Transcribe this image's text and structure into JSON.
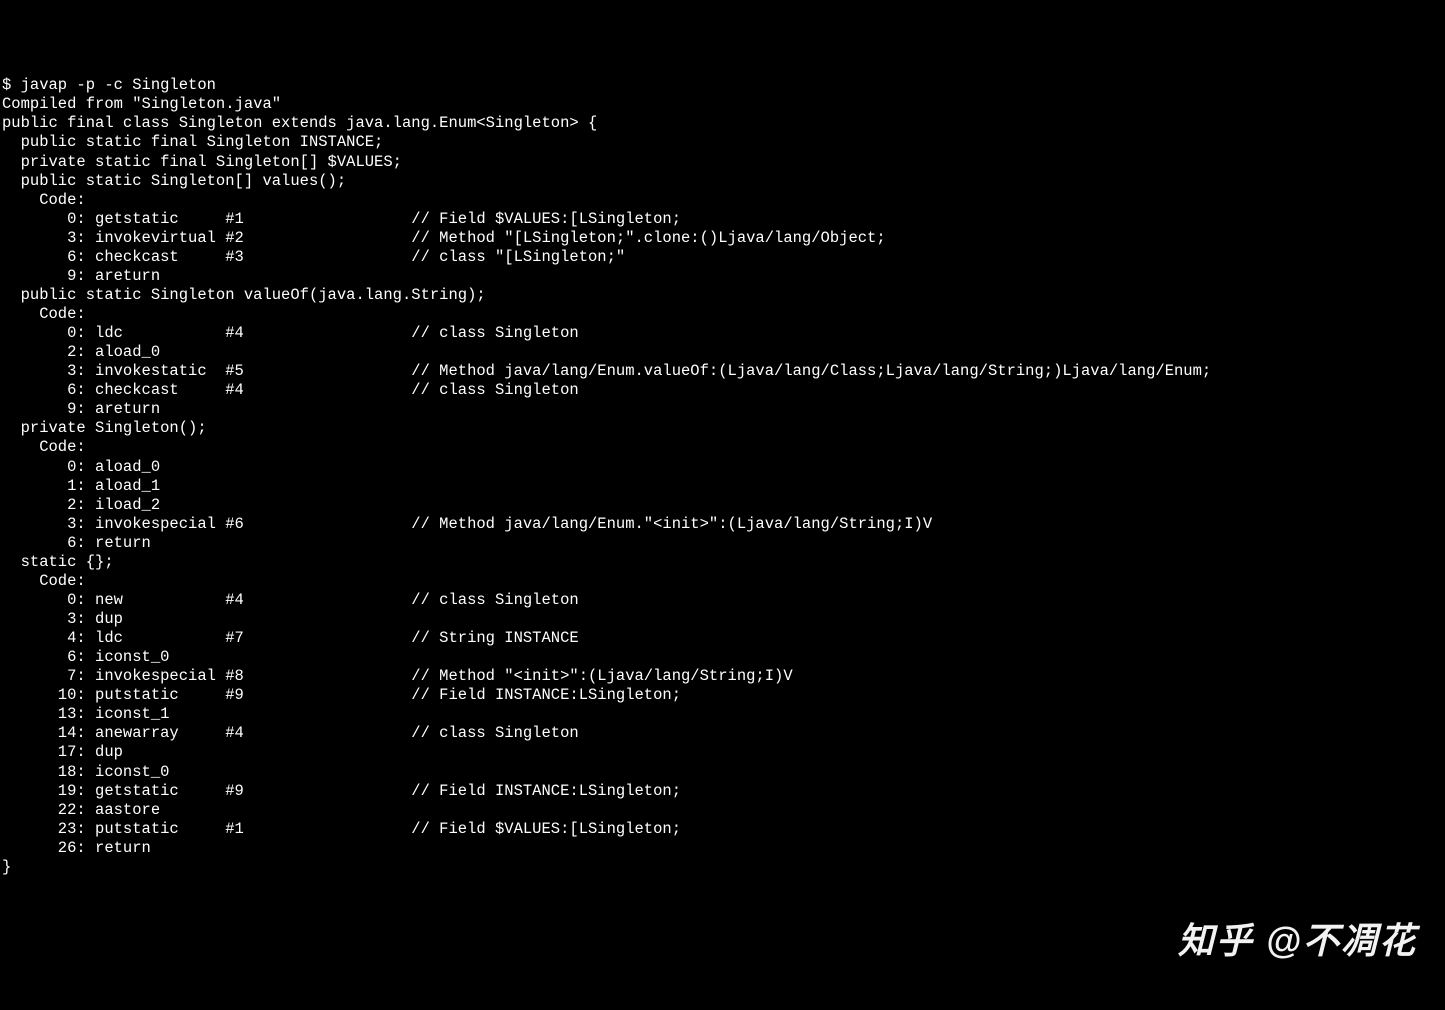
{
  "watermark": "知乎 @不凋花",
  "lines": [
    "$ javap -p -c Singleton",
    "Compiled from \"Singleton.java\"",
    "public final class Singleton extends java.lang.Enum<Singleton> {",
    "  public static final Singleton INSTANCE;",
    "",
    "  private static final Singleton[] $VALUES;",
    "",
    "  public static Singleton[] values();",
    "    Code:",
    "       0: getstatic     #1                  // Field $VALUES:[LSingleton;",
    "       3: invokevirtual #2                  // Method \"[LSingleton;\".clone:()Ljava/lang/Object;",
    "       6: checkcast     #3                  // class \"[LSingleton;\"",
    "       9: areturn",
    "",
    "  public static Singleton valueOf(java.lang.String);",
    "    Code:",
    "       0: ldc           #4                  // class Singleton",
    "       2: aload_0",
    "       3: invokestatic  #5                  // Method java/lang/Enum.valueOf:(Ljava/lang/Class;Ljava/lang/String;)Ljava/lang/Enum;",
    "       6: checkcast     #4                  // class Singleton",
    "       9: areturn",
    "",
    "  private Singleton();",
    "    Code:",
    "       0: aload_0",
    "       1: aload_1",
    "       2: iload_2",
    "       3: invokespecial #6                  // Method java/lang/Enum.\"<init>\":(Ljava/lang/String;I)V",
    "       6: return",
    "",
    "  static {};",
    "    Code:",
    "       0: new           #4                  // class Singleton",
    "       3: dup",
    "       4: ldc           #7                  // String INSTANCE",
    "       6: iconst_0",
    "       7: invokespecial #8                  // Method \"<init>\":(Ljava/lang/String;I)V",
    "      10: putstatic     #9                  // Field INSTANCE:LSingleton;",
    "      13: iconst_1",
    "      14: anewarray     #4                  // class Singleton",
    "      17: dup",
    "      18: iconst_0",
    "      19: getstatic     #9                  // Field INSTANCE:LSingleton;",
    "      22: aastore",
    "      23: putstatic     #1                  // Field $VALUES:[LSingleton;",
    "      26: return",
    "}"
  ]
}
